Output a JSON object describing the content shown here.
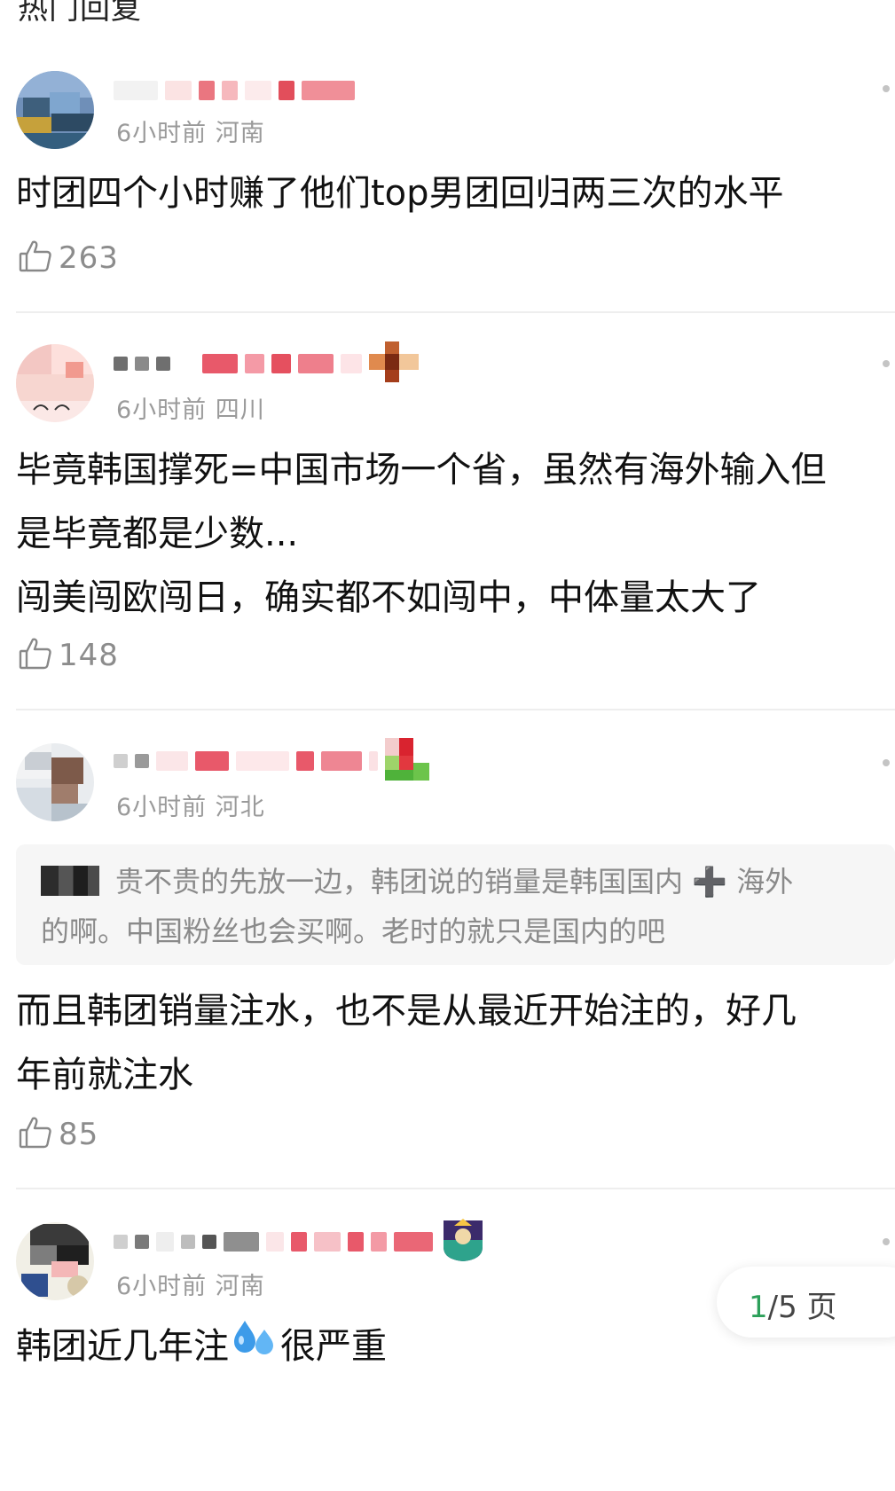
{
  "section": {
    "title": "热门回复"
  },
  "comments": [
    {
      "meta": "6小时前 河南",
      "lines": [
        "时团四个小时赚了他们top男团回归两三次的水平"
      ],
      "likes": "263"
    },
    {
      "meta": "6小时前 四川",
      "lines": [
        "毕竟韩国撑死=中国市场一个省，虽然有海外输入但",
        "是毕竟都是少数...",
        "闯美闯欧闯日，确实都不如闯中，中体量太大了"
      ],
      "likes": "148"
    },
    {
      "meta": "6小时前 河北",
      "quote": {
        "line1": "贵不贵的先放一边，韩团说的销量是韩国国内 ➕ 海外",
        "line2": "的啊。中国粉丝也会买啊。老时的就只是国内的吧"
      },
      "lines": [
        "而且韩团销量注水，也不是从最近开始注的，好几",
        "年前就注水"
      ],
      "likes": "85"
    },
    {
      "meta": "6小时前 河南",
      "text_before": "韩团近几年注",
      "text_after": "很严重"
    }
  ],
  "pagination": {
    "current": "1",
    "rest": "/5 页"
  },
  "colors": {
    "accent_green": "#2ca05a",
    "meta_gray": "#9a9a9a",
    "like_gray": "#8c8c8c",
    "quote_bg": "#f6f6f6"
  },
  "icons": [
    "thumbs-up-icon",
    "more-dots-icon",
    "sweat-drops-emoji"
  ]
}
